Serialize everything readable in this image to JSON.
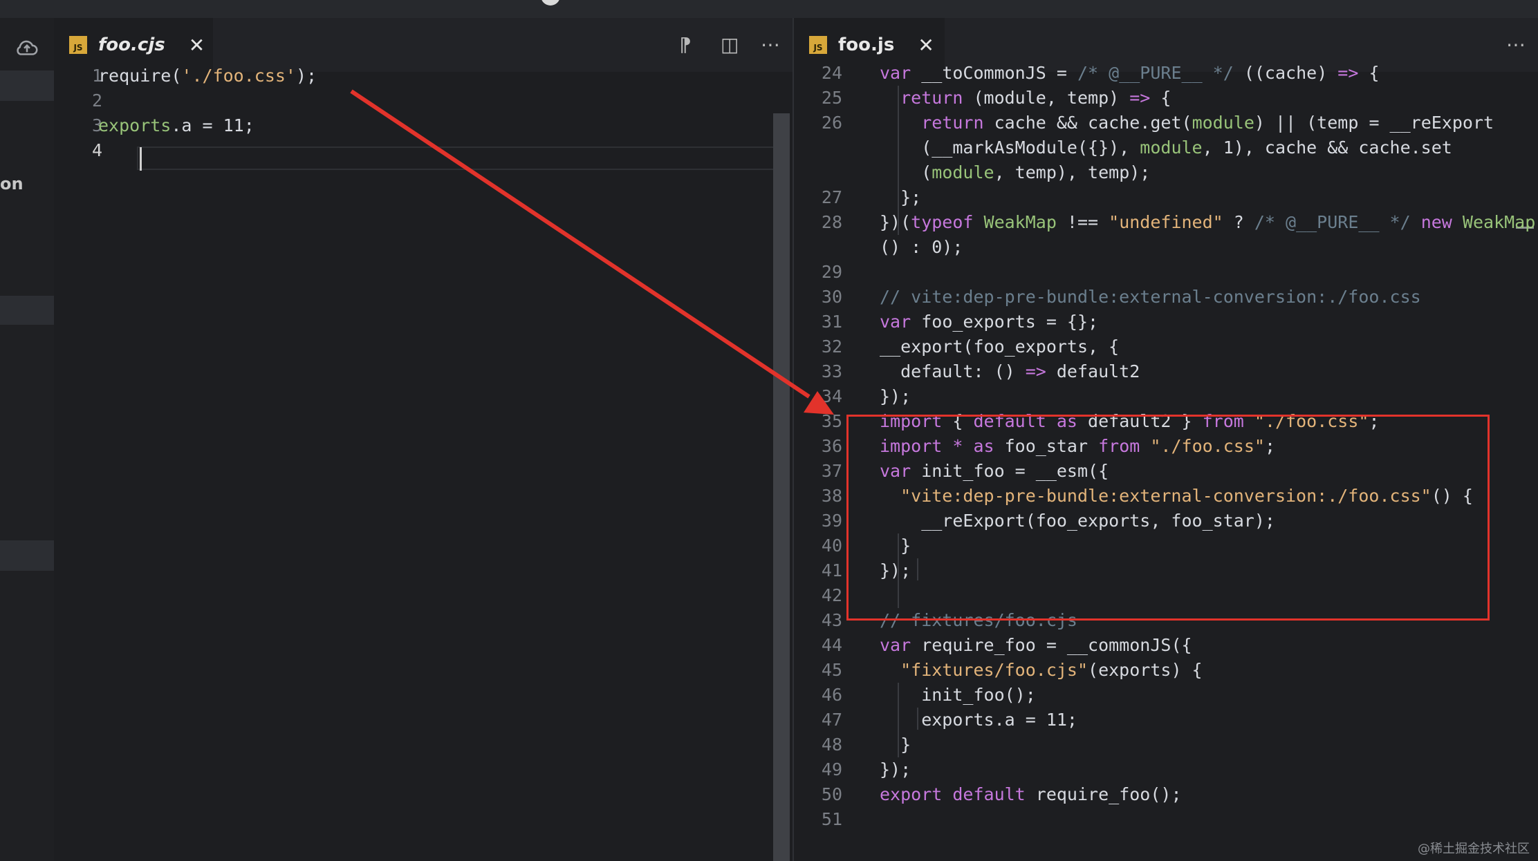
{
  "left_tab": {
    "badge": "JS",
    "title": "foo.cjs",
    "close": "✕"
  },
  "right_tab": {
    "badge": "JS",
    "title": "foo.js",
    "close": "✕"
  },
  "left_icons": {
    "format": "⁋",
    "split": "◫",
    "more": "⋯"
  },
  "right_icons": {
    "more": "⋯"
  },
  "activity_fragment": "on",
  "watermark": "@稀土掘金技术社区",
  "colors": {
    "annotation": "#e2332b",
    "keyword": "#c678dd",
    "string": "#e3b47a",
    "comment": "#6b7f8e"
  },
  "left_editor": {
    "lines": [
      {
        "num": "1",
        "tokens": [
          [
            "require(",
            "t-plain"
          ],
          [
            "'./foo.css'",
            "t-str"
          ],
          [
            ");",
            "t-plain"
          ]
        ]
      },
      {
        "num": "2",
        "tokens": []
      },
      {
        "num": "3",
        "tokens": [
          [
            "exports",
            "t-type"
          ],
          [
            ".a = 11;",
            "t-plain"
          ]
        ]
      },
      {
        "num": "4",
        "tokens": []
      }
    ]
  },
  "right_editor": {
    "lines": [
      {
        "num": "24",
        "tokens": [
          [
            "var ",
            "t-kw"
          ],
          [
            "__toCommonJS",
            "t-plain"
          ],
          [
            " = ",
            "t-plain"
          ],
          [
            "/* @__PURE__ */",
            "t-cm"
          ],
          [
            " ((cache) ",
            "t-plain"
          ],
          [
            "=>",
            "t-kw"
          ],
          [
            " {",
            "t-plain"
          ]
        ]
      },
      {
        "num": "25",
        "tokens": [
          [
            "  return ",
            "t-kw"
          ],
          [
            "(module, temp) ",
            "t-plain"
          ],
          [
            "=>",
            "t-kw"
          ],
          [
            " {",
            "t-plain"
          ]
        ]
      },
      {
        "num": "26",
        "tokens": [
          [
            "    return ",
            "t-kw"
          ],
          [
            "cache && cache.get(",
            "t-plain"
          ],
          [
            "module",
            "t-type"
          ],
          [
            ") || (temp = __reExport",
            "t-plain"
          ]
        ]
      },
      {
        "num": "",
        "tokens": [
          [
            "    (__markAsModule({}), ",
            "t-plain"
          ],
          [
            "module",
            "t-type"
          ],
          [
            ", 1), cache && cache.set",
            "t-plain"
          ]
        ]
      },
      {
        "num": "",
        "tokens": [
          [
            "    (",
            "t-plain"
          ],
          [
            "module",
            "t-type"
          ],
          [
            ", temp), temp);",
            "t-plain"
          ]
        ]
      },
      {
        "num": "27",
        "tokens": [
          [
            "  };",
            "t-plain"
          ]
        ]
      },
      {
        "num": "28",
        "tokens": [
          [
            "})(",
            "t-plain"
          ],
          [
            "typeof ",
            "t-kw"
          ],
          [
            "WeakMap",
            "t-type"
          ],
          [
            " !== ",
            "t-plain"
          ],
          [
            "\"undefined\"",
            "t-str"
          ],
          [
            " ? ",
            "t-plain"
          ],
          [
            "/* @__PURE__ */",
            "t-cm"
          ],
          [
            " new ",
            "t-kw"
          ],
          [
            "WeakMap",
            "t-type"
          ]
        ]
      },
      {
        "num": "",
        "tokens": [
          [
            "() : 0);",
            "t-plain"
          ]
        ]
      },
      {
        "num": "29",
        "tokens": []
      },
      {
        "num": "30",
        "tokens": [
          [
            "// vite:dep-pre-bundle:external-conversion:./foo.css",
            "t-cm"
          ]
        ]
      },
      {
        "num": "31",
        "tokens": [
          [
            "var ",
            "t-kw"
          ],
          [
            "foo_exports = {};",
            "t-plain"
          ]
        ]
      },
      {
        "num": "32",
        "tokens": [
          [
            "__export(foo_exports, {",
            "t-plain"
          ]
        ]
      },
      {
        "num": "33",
        "tokens": [
          [
            "  default: () ",
            "t-plain"
          ],
          [
            "=>",
            "t-kw"
          ],
          [
            " default2",
            "t-plain"
          ]
        ]
      },
      {
        "num": "34",
        "tokens": [
          [
            "});",
            "t-plain"
          ]
        ]
      },
      {
        "num": "35",
        "tokens": [
          [
            "import ",
            "t-kw"
          ],
          [
            "{ ",
            "t-plain"
          ],
          [
            "default as ",
            "t-kw"
          ],
          [
            "default2 } ",
            "t-plain"
          ],
          [
            "from ",
            "t-kw"
          ],
          [
            "\"./foo.css\"",
            "t-str"
          ],
          [
            ";",
            "t-plain"
          ]
        ]
      },
      {
        "num": "36",
        "tokens": [
          [
            "import ",
            "t-kw"
          ],
          [
            "* as ",
            "t-kw"
          ],
          [
            "foo_star ",
            "t-plain"
          ],
          [
            "from ",
            "t-kw"
          ],
          [
            "\"./foo.css\"",
            "t-str"
          ],
          [
            ";",
            "t-plain"
          ]
        ]
      },
      {
        "num": "37",
        "tokens": [
          [
            "var ",
            "t-kw"
          ],
          [
            "init_foo = __esm({",
            "t-plain"
          ]
        ]
      },
      {
        "num": "38",
        "tokens": [
          [
            "  \"vite:dep-pre-bundle:external-conversion:./foo.css\"",
            "t-str"
          ],
          [
            "() {",
            "t-plain"
          ]
        ]
      },
      {
        "num": "39",
        "tokens": [
          [
            "    __reExport(foo_exports, foo_star);",
            "t-plain"
          ]
        ]
      },
      {
        "num": "40",
        "tokens": [
          [
            "  }",
            "t-plain"
          ]
        ]
      },
      {
        "num": "41",
        "tokens": [
          [
            "});",
            "t-plain"
          ]
        ]
      },
      {
        "num": "42",
        "tokens": []
      },
      {
        "num": "43",
        "tokens": [
          [
            "// fixtures/foo.cjs",
            "t-cm"
          ]
        ]
      },
      {
        "num": "44",
        "tokens": [
          [
            "var ",
            "t-kw"
          ],
          [
            "require_foo = __commonJS({",
            "t-plain"
          ]
        ]
      },
      {
        "num": "45",
        "tokens": [
          [
            "  \"fixtures/foo.cjs\"",
            "t-str"
          ],
          [
            "(exports) {",
            "t-plain"
          ]
        ]
      },
      {
        "num": "46",
        "tokens": [
          [
            "    init_foo();",
            "t-plain"
          ]
        ]
      },
      {
        "num": "47",
        "tokens": [
          [
            "    exports.a = 11;",
            "t-plain"
          ]
        ]
      },
      {
        "num": "48",
        "tokens": [
          [
            "  }",
            "t-plain"
          ]
        ]
      },
      {
        "num": "49",
        "tokens": [
          [
            "});",
            "t-plain"
          ]
        ]
      },
      {
        "num": "50",
        "tokens": [
          [
            "export ",
            "t-kw"
          ],
          [
            "default ",
            "t-kw"
          ],
          [
            "require_foo();",
            "t-plain"
          ]
        ]
      },
      {
        "num": "51",
        "tokens": []
      }
    ]
  }
}
